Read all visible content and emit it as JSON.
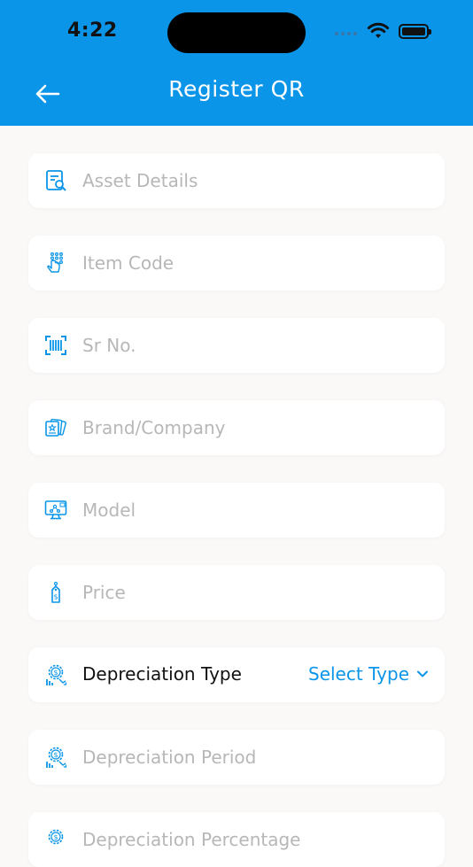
{
  "status_bar": {
    "time": "4:22",
    "icons": [
      "signal-icon",
      "wifi-icon",
      "battery-icon"
    ]
  },
  "header": {
    "title": "Register QR",
    "back_icon": "arrow-left-icon",
    "background_color": "#0a95e8"
  },
  "form": {
    "asset_details": {
      "placeholder": "Asset Details",
      "icon": "document-search-icon"
    },
    "item_code": {
      "placeholder": "Item Code",
      "icon": "keypad-hand-icon"
    },
    "sr_no": {
      "placeholder": "Sr No.",
      "icon": "barcode-scan-icon"
    },
    "brand": {
      "placeholder": "Brand/Company",
      "icon": "brand-cards-icon"
    },
    "model": {
      "placeholder": "Model",
      "icon": "monitor-model-icon"
    },
    "price": {
      "placeholder": "Price",
      "icon": "price-tag-icon"
    },
    "depreciation_type": {
      "label": "Depreciation Type",
      "value": "Select Type",
      "icon": "depreciation-icon"
    },
    "depreciation_period": {
      "placeholder": "Depreciation Period",
      "icon": "depreciation-icon"
    },
    "depreciation_percentage": {
      "placeholder": "Depreciation Percentage",
      "icon": "depreciation-icon"
    }
  }
}
